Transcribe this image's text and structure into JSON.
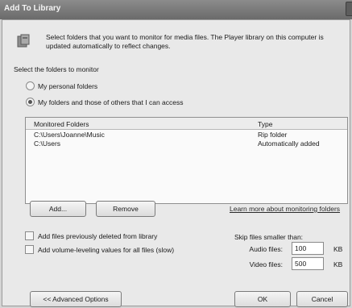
{
  "window": {
    "title": "Add To Library"
  },
  "header": {
    "description": "Select folders that you want to monitor for media files. The Player library on this computer is updated automatically to reflect changes."
  },
  "folders_section": {
    "label": "Select the folders to monitor",
    "options": [
      {
        "label": "My personal folders",
        "selected": false
      },
      {
        "label": "My folders and those of others that I can access",
        "selected": true
      }
    ]
  },
  "folder_list": {
    "columns": [
      "Monitored Folders",
      "Type"
    ],
    "rows": [
      {
        "folder": "C:\\Users\\Joanne\\Music",
        "type": "Rip folder"
      },
      {
        "folder": "C:\\Users",
        "type": "Automatically added"
      }
    ]
  },
  "list_actions": {
    "add_label": "Add...",
    "remove_label": "Remove",
    "learn_more_link": "Learn more about monitoring folders"
  },
  "options": {
    "add_deleted_label": "Add files previously deleted from library",
    "add_volume_label": "Add volume-leveling values for all files (slow)"
  },
  "skip": {
    "label": "Skip files smaller than:",
    "audio_label": "Audio files:",
    "audio_value": "100",
    "audio_unit": "KB",
    "video_label": "Video files:",
    "video_value": "500",
    "video_unit": "KB"
  },
  "footer": {
    "advanced_label": "<< Advanced Options",
    "ok_label": "OK",
    "cancel_label": "Cancel"
  }
}
